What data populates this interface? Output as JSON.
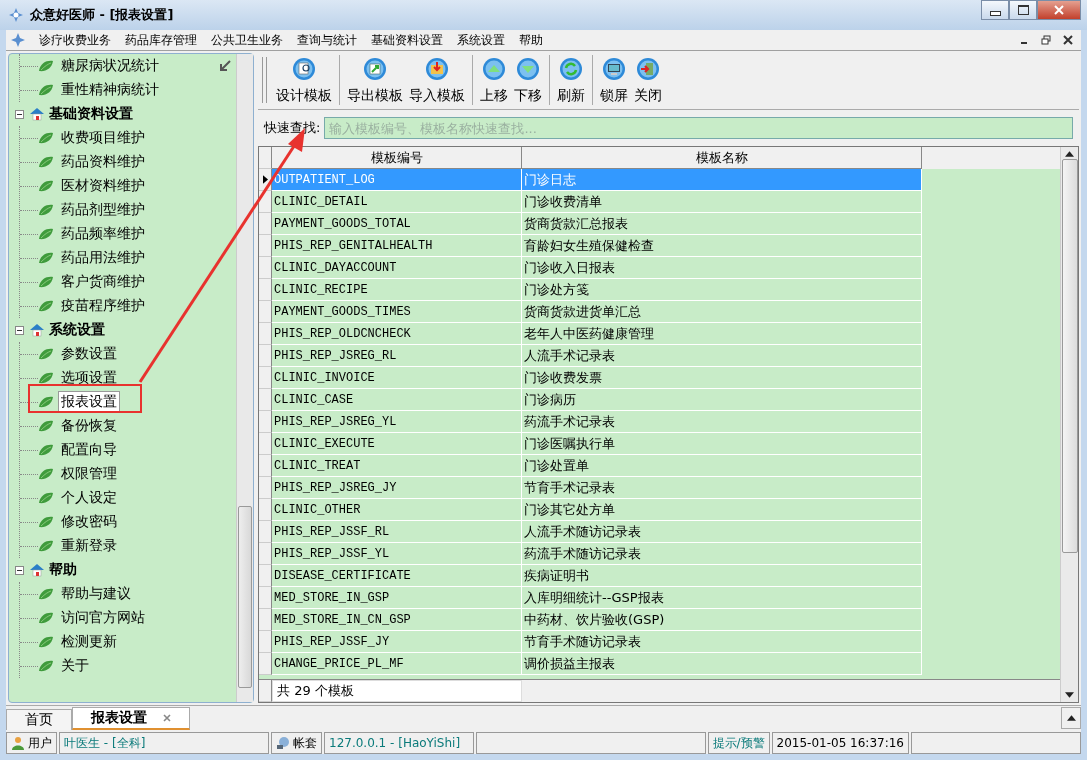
{
  "window": {
    "title": "众意好医师 - [报表设置]"
  },
  "menu": [
    "诊疗收费业务",
    "药品库存管理",
    "公共卫生业务",
    "查询与统计",
    "基础资料设置",
    "系统设置",
    "帮助"
  ],
  "tree": [
    {
      "children": [
        {
          "label": "糖尿病状况统计",
          "selected": false
        },
        {
          "label": "重性精神病统计",
          "selected": false
        }
      ]
    },
    {
      "label": "基础资料设置",
      "expanded": true,
      "children": [
        {
          "label": "收费项目维护",
          "selected": false
        },
        {
          "label": "药品资料维护",
          "selected": false
        },
        {
          "label": "医材资料维护",
          "selected": false
        },
        {
          "label": "药品剂型维护",
          "selected": false
        },
        {
          "label": "药品频率维护",
          "selected": false
        },
        {
          "label": "药品用法维护",
          "selected": false
        },
        {
          "label": "客户货商维护",
          "selected": false
        },
        {
          "label": "疫苗程序维护",
          "selected": false
        }
      ]
    },
    {
      "label": "系统设置",
      "expanded": true,
      "children": [
        {
          "label": "参数设置",
          "selected": false
        },
        {
          "label": "选项设置",
          "selected": false
        },
        {
          "label": "报表设置",
          "selected": true
        },
        {
          "label": "备份恢复",
          "selected": false
        },
        {
          "label": "配置向导",
          "selected": false
        },
        {
          "label": "权限管理",
          "selected": false
        },
        {
          "label": "个人设定",
          "selected": false
        },
        {
          "label": "修改密码",
          "selected": false
        },
        {
          "label": "重新登录",
          "selected": false
        }
      ]
    },
    {
      "label": "帮助",
      "expanded": true,
      "children": [
        {
          "label": "帮助与建议",
          "selected": false
        },
        {
          "label": "访问官方网站",
          "selected": false
        },
        {
          "label": "检测更新",
          "selected": false
        },
        {
          "label": "关于",
          "selected": false
        }
      ]
    }
  ],
  "toolbar": [
    {
      "label": "设计模板",
      "kind": "design"
    },
    {
      "label": "导出模板",
      "kind": "export"
    },
    {
      "label": "导入模板",
      "kind": "import"
    },
    {
      "label": "上移",
      "kind": "up"
    },
    {
      "label": "下移",
      "kind": "down"
    },
    {
      "label": "刷新",
      "kind": "refresh"
    },
    {
      "label": "锁屏",
      "kind": "lock"
    },
    {
      "label": "关闭",
      "kind": "close"
    }
  ],
  "search": {
    "label": "快速查找:",
    "placeholder": "输入模板编号、模板名称快速查找..."
  },
  "table": {
    "columns": [
      "模板编号",
      "模板名称"
    ],
    "rows": [
      {
        "code": "OUTPATIENT_LOG",
        "name": "门诊日志",
        "selected": true
      },
      {
        "code": "CLINIC_DETAIL",
        "name": "门诊收费清单",
        "selected": false
      },
      {
        "code": "PAYMENT_GOODS_TOTAL",
        "name": "货商货款汇总报表",
        "selected": false
      },
      {
        "code": "PHIS_REP_GENITALHEALTH",
        "name": "育龄妇女生殖保健检查",
        "selected": false
      },
      {
        "code": "CLINIC_DAYACCOUNT",
        "name": "门诊收入日报表",
        "selected": false
      },
      {
        "code": "CLINIC_RECIPE",
        "name": "门诊处方笺",
        "selected": false
      },
      {
        "code": "PAYMENT_GOODS_TIMES",
        "name": "货商货款进货单汇总",
        "selected": false
      },
      {
        "code": "PHIS_REP_OLDCNCHECK",
        "name": "老年人中医药健康管理",
        "selected": false
      },
      {
        "code": "PHIS_REP_JSREG_RL",
        "name": "人流手术记录表",
        "selected": false
      },
      {
        "code": "CLINIC_INVOICE",
        "name": "门诊收费发票",
        "selected": false
      },
      {
        "code": "CLINIC_CASE",
        "name": "门诊病历",
        "selected": false
      },
      {
        "code": "PHIS_REP_JSREG_YL",
        "name": "药流手术记录表",
        "selected": false
      },
      {
        "code": "CLINIC_EXECUTE",
        "name": "门诊医嘱执行单",
        "selected": false
      },
      {
        "code": "CLINIC_TREAT",
        "name": "门诊处置单",
        "selected": false
      },
      {
        "code": "PHIS_REP_JSREG_JY",
        "name": "节育手术记录表",
        "selected": false
      },
      {
        "code": "CLINIC_OTHER",
        "name": "门诊其它处方单",
        "selected": false
      },
      {
        "code": "PHIS_REP_JSSF_RL",
        "name": "人流手术随访记录表",
        "selected": false
      },
      {
        "code": "PHIS_REP_JSSF_YL",
        "name": "药流手术随访记录表",
        "selected": false
      },
      {
        "code": "DISEASE_CERTIFICATE",
        "name": "疾病证明书",
        "selected": false
      },
      {
        "code": "MED_STORE_IN_GSP",
        "name": "入库明细统计--GSP报表",
        "selected": false
      },
      {
        "code": "MED_STORE_IN_CN_GSP",
        "name": "中药材、饮片验收(GSP)",
        "selected": false
      },
      {
        "code": "PHIS_REP_JSSF_JY",
        "name": "节育手术随访记录表",
        "selected": false
      },
      {
        "code": "CHANGE_PRICE_PL_MF",
        "name": "调价损益主报表",
        "selected": false
      }
    ],
    "footer": "共 29 个模板"
  },
  "tabs": [
    {
      "label": "首页",
      "selected": false
    },
    {
      "label": "报表设置",
      "selected": true
    }
  ],
  "status_bar": {
    "user_label": "用户",
    "user": "叶医生 - [全科]",
    "account_label": "帐套",
    "account": "127.0.0.1 - [HaoYiShi]",
    "alert": "提示/预警",
    "datetime": "2015-01-05 16:37:16"
  }
}
